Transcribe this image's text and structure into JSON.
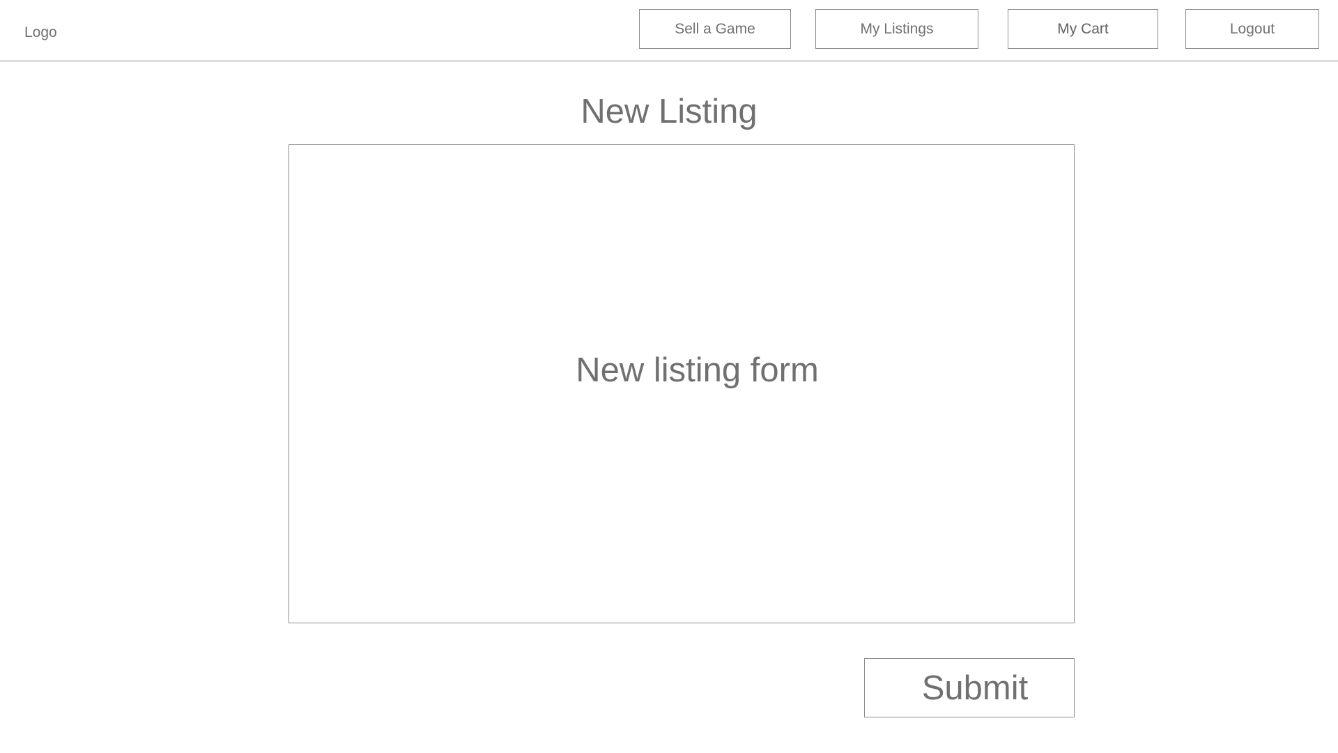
{
  "header": {
    "logo": "Logo",
    "nav": {
      "sell_label": "Sell a Game",
      "listings_label": "My Listings",
      "cart_label": "My Cart",
      "logout_label": "Logout"
    }
  },
  "main": {
    "title": "New Listing",
    "form_placeholder": "New listing form",
    "submit_label": "Submit"
  },
  "colors": {
    "text": "#707070",
    "border": "#8a8a8a",
    "background": "#ffffff"
  }
}
